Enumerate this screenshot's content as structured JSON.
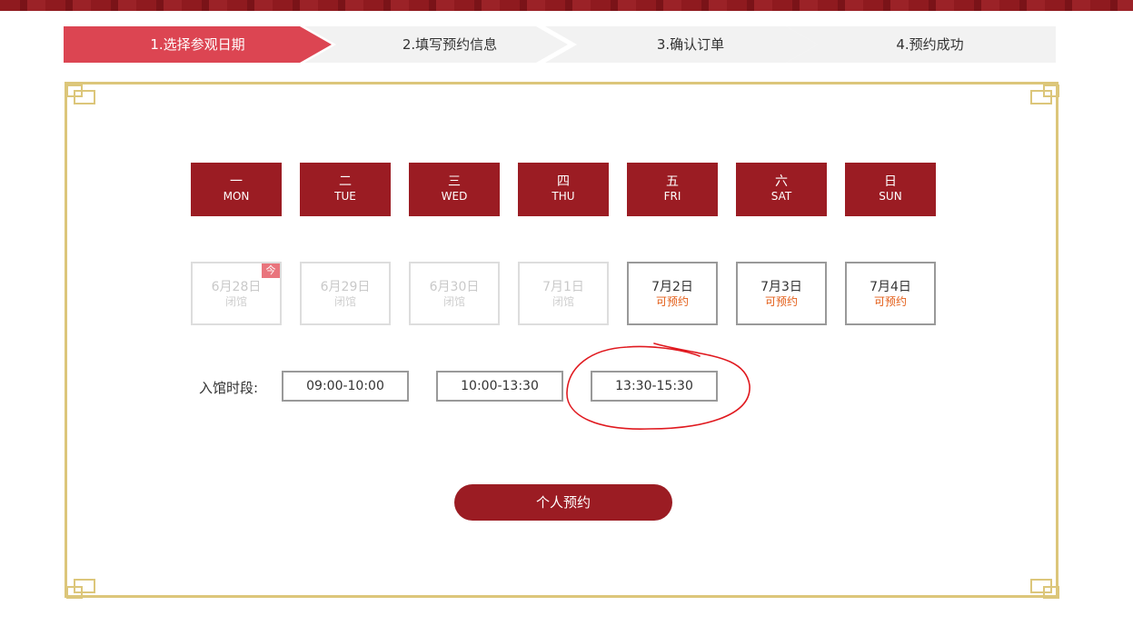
{
  "steps": [
    {
      "label": "1.选择参观日期",
      "active": true
    },
    {
      "label": "2.填写预约信息",
      "active": false
    },
    {
      "label": "3.确认订单",
      "active": false
    },
    {
      "label": "4.预约成功",
      "active": false
    }
  ],
  "weekdays": [
    {
      "cn": "一",
      "en": "MON"
    },
    {
      "cn": "二",
      "en": "TUE"
    },
    {
      "cn": "三",
      "en": "WED"
    },
    {
      "cn": "四",
      "en": "THU"
    },
    {
      "cn": "五",
      "en": "FRI"
    },
    {
      "cn": "六",
      "en": "SAT"
    },
    {
      "cn": "日",
      "en": "SUN"
    }
  ],
  "dates": [
    {
      "date": "6月28日",
      "status": "闭馆",
      "badge": "今"
    },
    {
      "date": "6月29日",
      "status": "闭馆"
    },
    {
      "date": "6月30日",
      "status": "闭馆"
    },
    {
      "date": "7月1日",
      "status": "闭馆"
    },
    {
      "date": "7月2日",
      "status": "可预约"
    },
    {
      "date": "7月3日",
      "status": "可预约"
    },
    {
      "date": "7月4日",
      "status": "可预约"
    }
  ],
  "time_slots": {
    "label": "入馆时段:",
    "options": [
      "09:00-10:00",
      "10:00-13:30",
      "13:30-15:30"
    ]
  },
  "book_button": "个人预约",
  "colors": {
    "primary": "#9b1c23",
    "step_active": "#dc4552",
    "available_text": "#e35d17",
    "frame_gold": "#dcc67a",
    "annotation": "#e0191f"
  }
}
